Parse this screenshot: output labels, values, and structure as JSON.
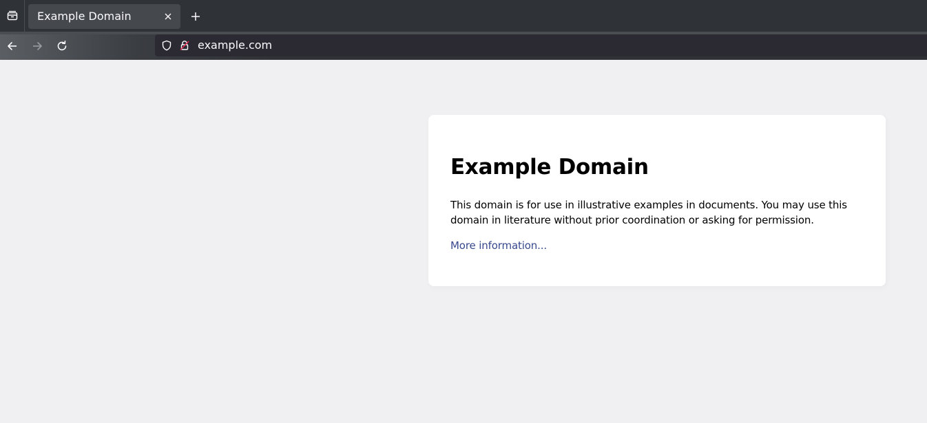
{
  "browser": {
    "tab": {
      "title": "Example Domain"
    },
    "address_bar": {
      "url": "example.com"
    },
    "icons": {
      "tab_list": "tab-list-icon",
      "close_tab": "close-icon",
      "new_tab": "plus-icon",
      "back": "arrow-left-icon",
      "forward": "arrow-right-icon",
      "reload": "reload-icon",
      "tracking_protection": "shield-icon",
      "insecure_lock": "lock-icon"
    },
    "colors": {
      "tabbar_bg": "#2f3237",
      "active_tab_bg": "#45484d",
      "urlbar_bg": "#2b2a33",
      "chrome_text": "#fbfbfe",
      "lock_warning": "#e22850"
    }
  },
  "page": {
    "heading": "Example Domain",
    "description": "This domain is for use in illustrative examples in documents. You may use this domain in literature without prior coordination or asking for permission.",
    "link_text": "More information...",
    "colors": {
      "background": "#f0f0f2",
      "card": "#ffffff",
      "link": "#38488f"
    }
  }
}
